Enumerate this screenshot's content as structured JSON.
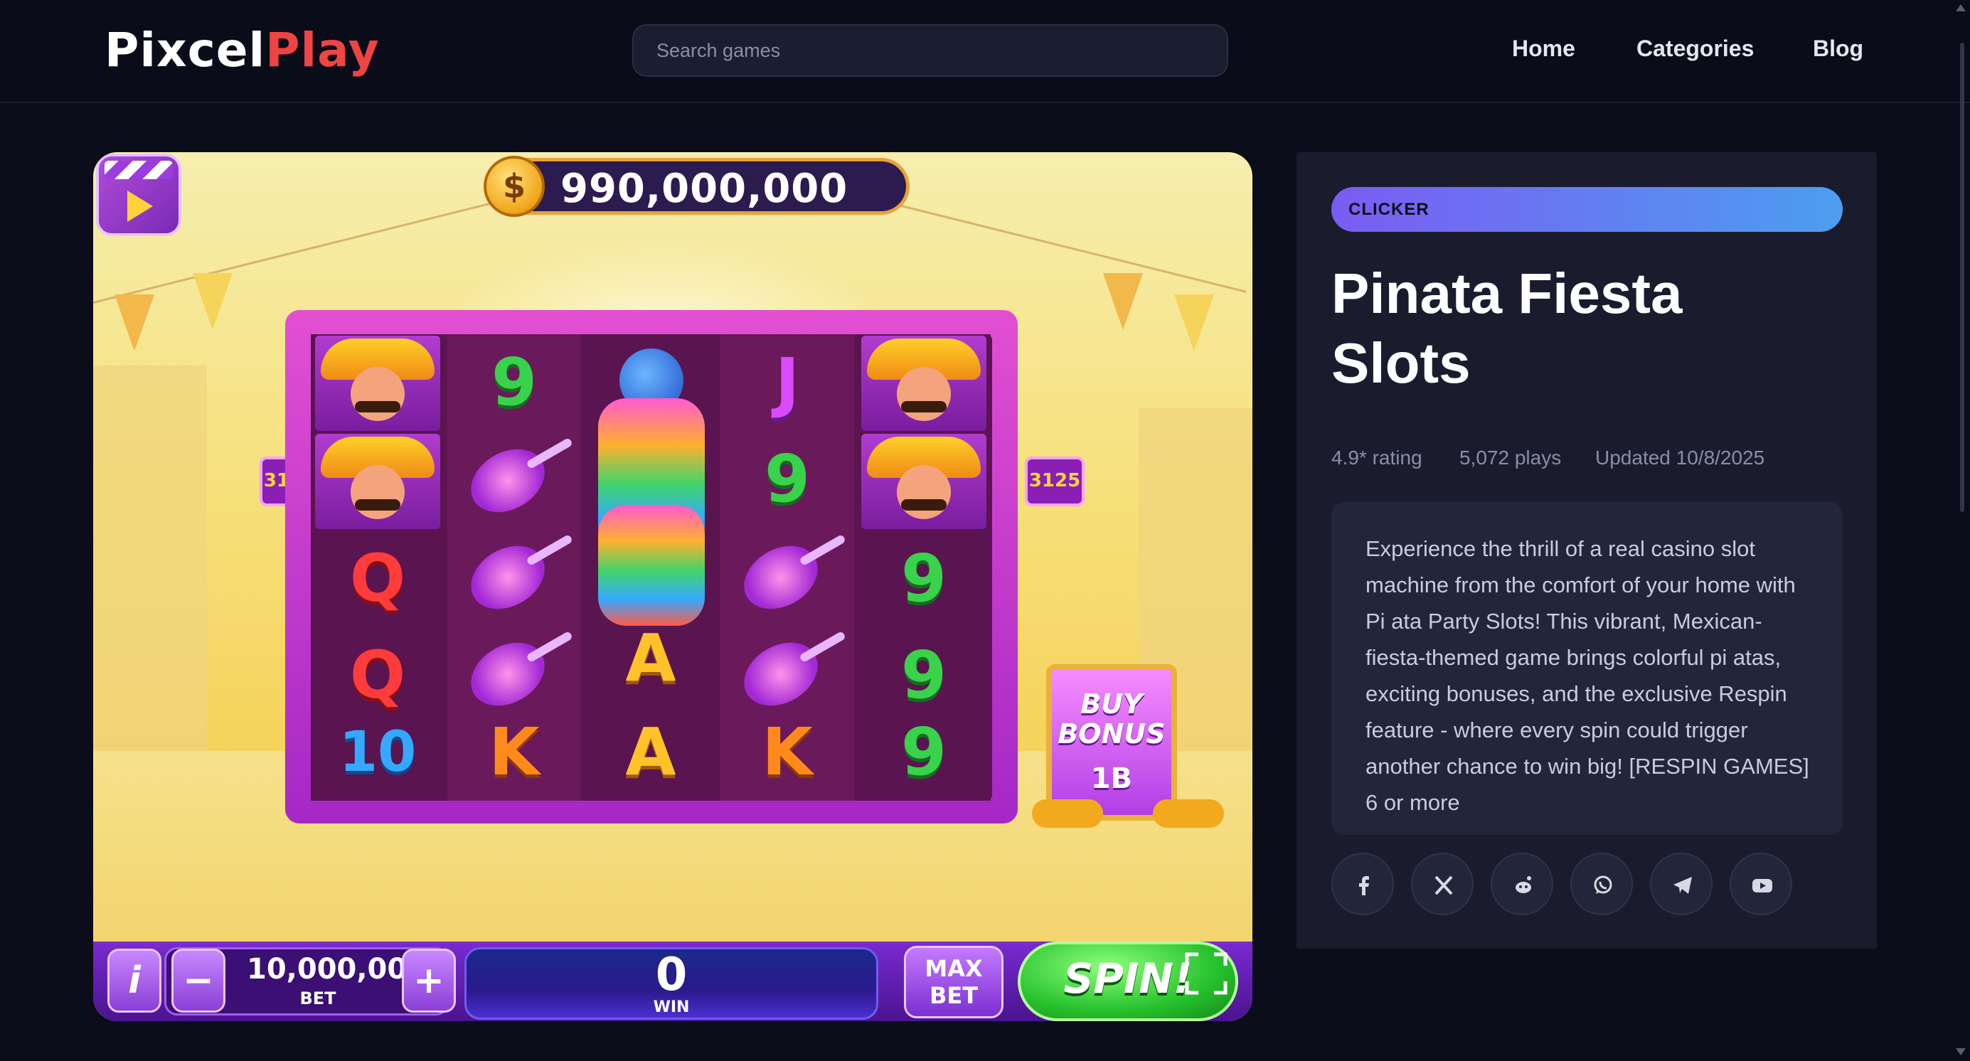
{
  "header": {
    "logo_part1": "Pixcel",
    "logo_part2": "Play",
    "search_placeholder": "Search games",
    "nav": [
      "Home",
      "Categories",
      "Blog"
    ]
  },
  "game": {
    "coin_symbol": "$",
    "balance": "990,000,000",
    "side_multiplier_left": "3125",
    "side_multiplier_right": "3125",
    "reels": [
      [
        "mexican",
        "mexican",
        "Q",
        "Q",
        "10"
      ],
      [
        "9",
        "guitar",
        "guitar",
        "guitar",
        "K"
      ],
      [
        "maraca",
        "pinata",
        "pinata",
        "A",
        "A"
      ],
      [
        "J",
        "9",
        "guitar",
        "guitar",
        "K"
      ],
      [
        "mexican",
        "mexican",
        "9",
        "9",
        "9"
      ]
    ],
    "buy_bonus_line1": "BUY",
    "buy_bonus_line2": "BONUS",
    "buy_bonus_price": "1B",
    "info_label": "i",
    "minus_label": "−",
    "plus_label": "+",
    "bet_value": "10,000,000",
    "bet_label": "BET",
    "win_value": "0",
    "win_label": "WIN",
    "max_bet_line1": "MAX",
    "max_bet_line2": "BET",
    "spin_label": "SPIN!"
  },
  "panel": {
    "category": "CLICKER",
    "title": "Pinata Fiesta Slots",
    "rating": "4.9* rating",
    "plays": "5,072 plays",
    "updated": "Updated 10/8/2025",
    "description": "Experience the thrill of a real casino slot machine from the comfort of your home with Pi ata Party Slots! This vibrant, Mexican-fiesta-themed game brings colorful pi atas, exciting bonuses, and the exclusive Respin feature - where every spin could trigger another chance to win big! [RESPIN GAMES] 6 or more",
    "share_icons": [
      "facebook-icon",
      "x-icon",
      "reddit-icon",
      "whatsapp-icon",
      "telegram-icon",
      "youtube-icon"
    ]
  },
  "colors": {
    "background": "#0c0d1b",
    "panel": "#1a1c2e",
    "logo_accent": "#ef4444",
    "tag_gradient_start": "#7b5cf2",
    "tag_gradient_end": "#4c9ef0"
  }
}
